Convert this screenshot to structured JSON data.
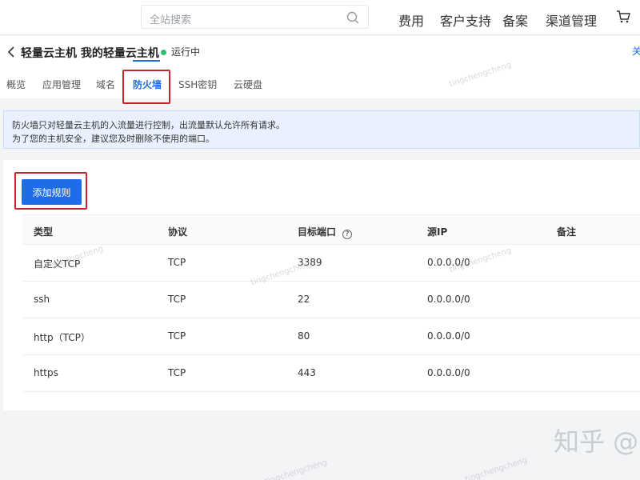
{
  "topbar": {
    "search_placeholder": "全站搜索",
    "links": [
      "费用",
      "客户支持",
      "备案",
      "渠道管理"
    ]
  },
  "header": {
    "title": "轻量云主机 我的轻量云主机",
    "status": "运行中",
    "edge_text": "关"
  },
  "tabs": [
    {
      "label": "概览",
      "active": false
    },
    {
      "label": "应用管理",
      "active": false
    },
    {
      "label": "域名",
      "active": false
    },
    {
      "label": "防火墙",
      "active": true
    },
    {
      "label": "SSH密钥",
      "active": false
    },
    {
      "label": "云硬盘",
      "active": false
    }
  ],
  "notice": {
    "line1": "防火墙只对轻量云主机的入流量进行控制，出流量默认允许所有请求。",
    "line2": "为了您的主机安全，建议您及时删除不使用的端口。"
  },
  "firewall": {
    "add_button": "添加规则",
    "columns": [
      "类型",
      "协议",
      "目标端口",
      "源IP",
      "备注"
    ],
    "help_glyph": "?",
    "rows": [
      {
        "type": "自定义TCP",
        "protocol": "TCP",
        "port": "3389",
        "source_ip": "0.0.0.0/0",
        "note": ""
      },
      {
        "type": "ssh",
        "protocol": "TCP",
        "port": "22",
        "source_ip": "0.0.0.0/0",
        "note": ""
      },
      {
        "type": "http（TCP）",
        "protocol": "TCP",
        "port": "80",
        "source_ip": "0.0.0.0/0",
        "note": ""
      },
      {
        "type": "https",
        "protocol": "TCP",
        "port": "443",
        "source_ip": "0.0.0.0/0",
        "note": ""
      }
    ]
  },
  "watermark": {
    "brand": "知乎 @",
    "text": "tingchengcheng"
  },
  "colors": {
    "accent": "#1e6ce8",
    "highlight_box": "#c8242b",
    "status_running": "#2dbd6e",
    "notice_bg": "#e9f1ff"
  }
}
